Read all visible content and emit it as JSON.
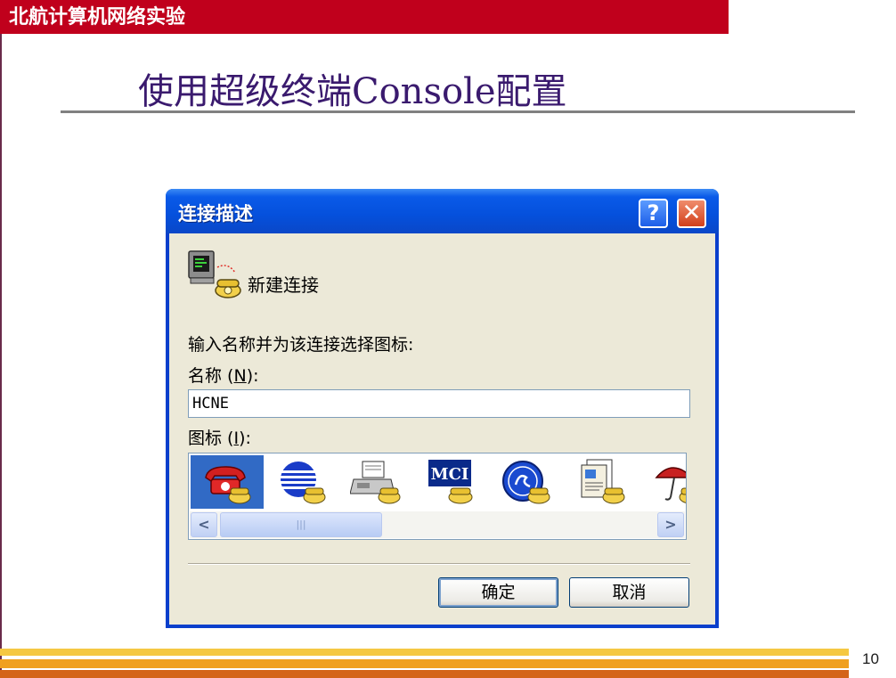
{
  "slide": {
    "header": "北航计算机网络实验",
    "title": "使用超级终端Console配置",
    "page_number": "10"
  },
  "dialog": {
    "title": "连接描述",
    "help_symbol": "?",
    "close_symbol": "✕",
    "connection_name": "新建连接",
    "prompt": "输入名称并为该连接选择图标:",
    "name_label": "名称",
    "name_hotkey": "N",
    "icon_label": "图标",
    "icon_hotkey": "I",
    "name_value": "HCNE",
    "icons": [
      "red-phone-icon",
      "blue-globe-icon",
      "fax-icon",
      "mci-icon",
      "ge-icon",
      "document-icon",
      "umbrella-icon"
    ],
    "mci_text": "MCI",
    "scroll_left": "<",
    "scroll_right": ">",
    "scroll_thumb_grip": "|||",
    "ok_label": "确定",
    "cancel_label": "取消"
  },
  "colors": {
    "header_red": "#c0001c",
    "title_purple": "#3a1a6e",
    "xp_blue": "#0a3fcc",
    "selection": "#316ac5"
  }
}
